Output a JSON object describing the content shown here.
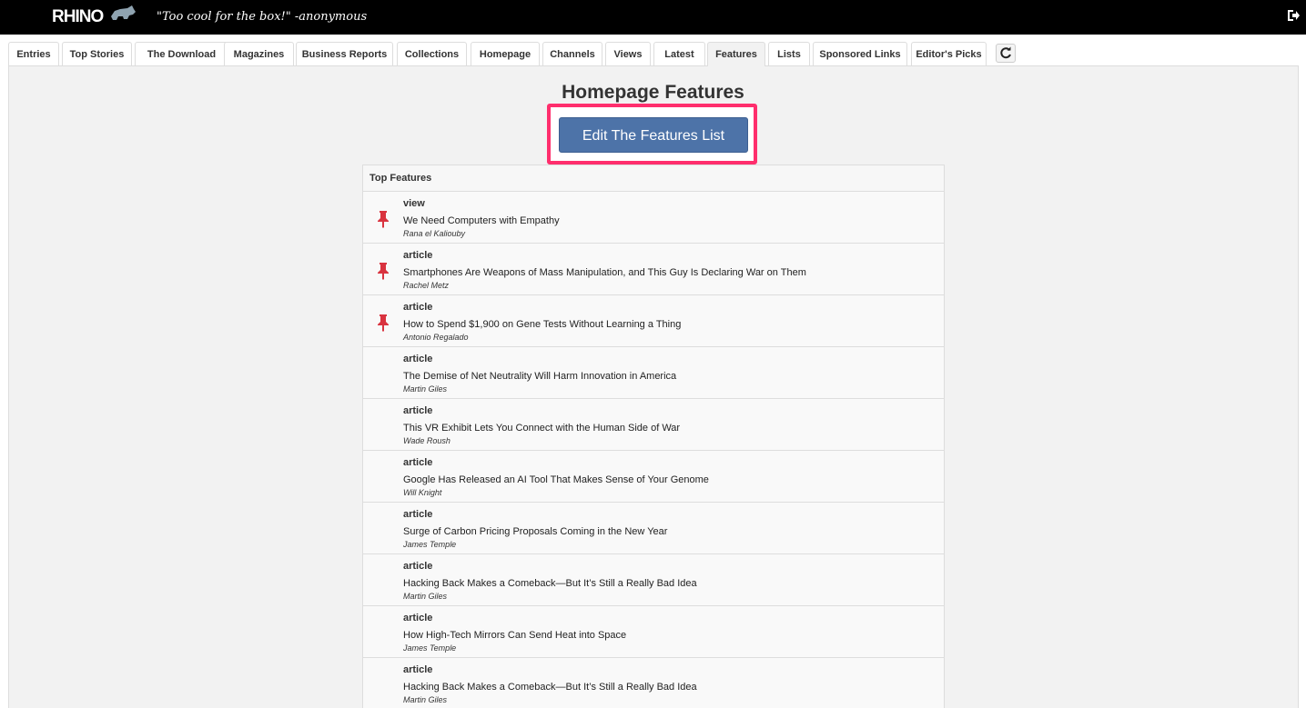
{
  "header": {
    "logo_text": "RHINO",
    "tagline": "\"Too cool for the box!\" -anonymous"
  },
  "tabs": [
    {
      "label": "Entries"
    },
    {
      "label": "Top Stories"
    },
    {
      "label": "The Download"
    },
    {
      "label": "Magazines"
    },
    {
      "label": "Business Reports"
    },
    {
      "label": "Collections"
    },
    {
      "label": "Homepage"
    },
    {
      "label": "Channels"
    },
    {
      "label": "Views"
    },
    {
      "label": "Latest"
    },
    {
      "label": "Features",
      "active": true
    },
    {
      "label": "Lists"
    },
    {
      "label": "Sponsored Links"
    },
    {
      "label": "Editor's Picks"
    }
  ],
  "main": {
    "title": "Homepage Features",
    "edit_button": "Edit The Features List",
    "list_header": "Top Features",
    "highlight_color": "#ff2e6d",
    "button_color": "#4d73a8",
    "pin_color": "#d9333f",
    "items": [
      {
        "type": "view",
        "title": "We Need Computers with Empathy",
        "author": "Rana el Kaliouby",
        "pinned": true
      },
      {
        "type": "article",
        "title": "Smartphones Are Weapons of Mass Manipulation, and This Guy Is Declaring War on Them",
        "author": "Rachel Metz",
        "pinned": true
      },
      {
        "type": "article",
        "title": "How to Spend $1,900 on Gene Tests Without Learning a Thing",
        "author": "Antonio Regalado",
        "pinned": true
      },
      {
        "type": "article",
        "title": "The Demise of Net Neutrality Will Harm Innovation in America",
        "author": "Martin Giles",
        "pinned": false
      },
      {
        "type": "article",
        "title": "This VR Exhibit Lets You Connect with the Human Side of War",
        "author": "Wade Roush",
        "pinned": false
      },
      {
        "type": "article",
        "title": "Google Has Released an AI Tool That Makes Sense of Your Genome",
        "author": "Will Knight",
        "pinned": false
      },
      {
        "type": "article",
        "title": "Surge of Carbon Pricing Proposals Coming in the New Year",
        "author": "James Temple",
        "pinned": false
      },
      {
        "type": "article",
        "title": "Hacking Back Makes a Comeback—But It’s Still a Really Bad Idea",
        "author": "Martin Giles",
        "pinned": false
      },
      {
        "type": "article",
        "title": "How High-Tech Mirrors Can Send Heat into Space",
        "author": "James Temple",
        "pinned": false
      },
      {
        "type": "article",
        "title": "Hacking Back Makes a Comeback—But It’s Still a Really Bad Idea",
        "author": "Martin Giles",
        "pinned": false
      }
    ]
  }
}
